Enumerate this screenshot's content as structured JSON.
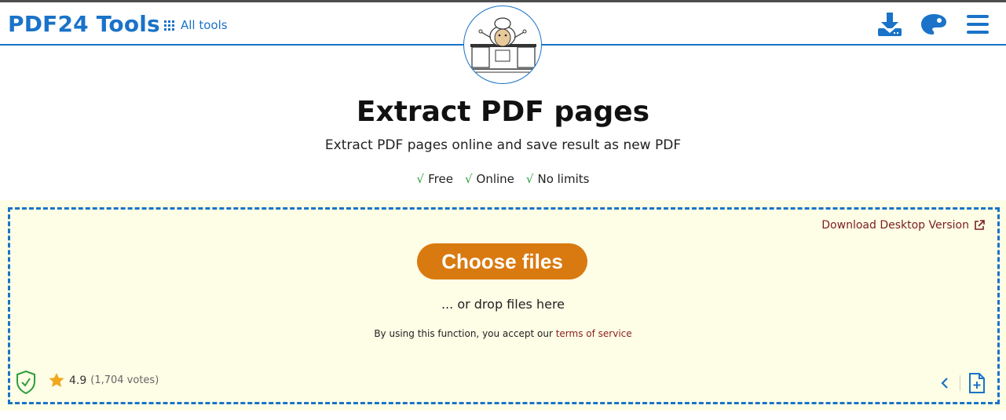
{
  "header": {
    "logo": "PDF24 Tools",
    "all_tools": "All tools",
    "icons": [
      "download-icon",
      "palette-icon",
      "menu-icon"
    ]
  },
  "hero": {
    "title": "Extract PDF pages",
    "subtitle": "Extract PDF pages online and save result as new PDF",
    "features": [
      "Free",
      "Online",
      "No limits"
    ],
    "check_glyph": "√"
  },
  "dropzone": {
    "desktop_link": "Download Desktop Version",
    "choose_button": "Choose files",
    "drop_text": "... or drop files here",
    "terms_prefix": "By using this function, you accept our",
    "terms_link": "terms of service"
  },
  "footer_bar": {
    "rating": "4.9",
    "votes": "(1,704 votes)"
  },
  "colors": {
    "brand_blue": "#1a73c8",
    "button_orange": "#d97a10",
    "dropzone_bg": "#fefde6",
    "link_red": "#7a1f1f",
    "check_green": "#2e9e3e",
    "star_gold": "#f0a81c"
  }
}
